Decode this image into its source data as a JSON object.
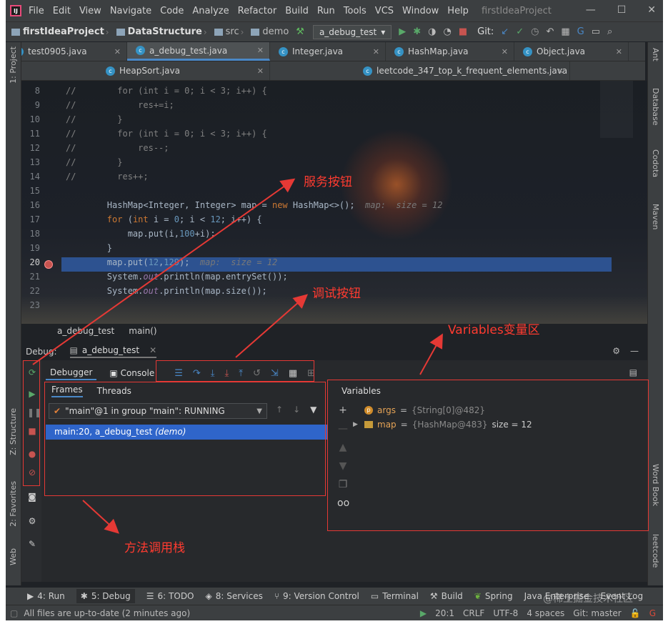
{
  "menubar": {
    "items": [
      "File",
      "Edit",
      "View",
      "Navigate",
      "Code",
      "Analyze",
      "Refactor",
      "Build",
      "Run",
      "Tools",
      "VCS",
      "Window",
      "Help"
    ],
    "title": "firstIdeaProject"
  },
  "navbar": {
    "crumbs": [
      "firstIdeaProject",
      "DataStructure",
      "src",
      "demo"
    ],
    "run_config": "a_debug_test",
    "git_label": "Git:"
  },
  "tabs_row1": [
    "test0905.java",
    "a_debug_test.java",
    "Integer.java",
    "HashMap.java",
    "Object.java"
  ],
  "tabs_row2": [
    "HeapSort.java",
    "leetcode_347_top_k_frequent_elements.java"
  ],
  "left_strip": {
    "project": "1: Project",
    "structure": "Z: Structure",
    "favorites": "2: Favorites",
    "web": "Web"
  },
  "right_strip": {
    "ant": "Ant",
    "database": "Database",
    "codota": "Codota",
    "maven": "Maven",
    "wordbook": "Word Book",
    "leetcode": "leetcode"
  },
  "editor": {
    "lines": [
      {
        "n": "8",
        "text": "//        for (int i = 0; i < 3; i++) {"
      },
      {
        "n": "9",
        "text": "//            res+=i;"
      },
      {
        "n": "10",
        "text": "//        }"
      },
      {
        "n": "11",
        "text": "//        for (int i = 0; i < 3; i++) {"
      },
      {
        "n": "12",
        "text": "//            res--;"
      },
      {
        "n": "13",
        "text": "//        }"
      },
      {
        "n": "14",
        "text": "//        res++;"
      },
      {
        "n": "15",
        "text": ""
      },
      {
        "n": "16",
        "text": "        HashMap<Integer, Integer> map = new HashMap<>();"
      },
      {
        "n": "17",
        "text": "        for (int i = 0; i < 12; i++) {"
      },
      {
        "n": "18",
        "text": "            map.put(i,100+i);"
      },
      {
        "n": "19",
        "text": "        }"
      },
      {
        "n": "20",
        "text": "        map.put(12,129);"
      },
      {
        "n": "21",
        "text": "        System.out.println(map.entrySet());"
      },
      {
        "n": "22",
        "text": "        System.out.println(map.size());"
      },
      {
        "n": "23",
        "text": ""
      }
    ],
    "hint16": "map:  size = 12",
    "hint20": "map:  size = 12",
    "breadcrumb_class": "a_debug_test",
    "breadcrumb_method": "main()"
  },
  "debug": {
    "label": "Debug:",
    "tab": "a_debug_test",
    "subtabs": [
      "Debugger",
      "Console"
    ],
    "frames_tabs": [
      "Frames",
      "Threads"
    ],
    "thread": "\"main\"@1 in group \"main\": RUNNING",
    "frame_row": "main:20, a_debug_test",
    "frame_row_pkg": "(demo)",
    "variables_title": "Variables",
    "vars": [
      {
        "name": "args",
        "value": "{String[0]@482}",
        "extra": ""
      },
      {
        "name": "map",
        "value": "{HashMap@483}",
        "extra": " size = 12"
      }
    ]
  },
  "annotations": {
    "service_buttons": "服务按钮",
    "debug_buttons": "调试按钮",
    "variables_area": "Variables变量区",
    "call_stack": "方法调用栈"
  },
  "bottom_bar": [
    "4: Run",
    "5: Debug",
    "6: TODO",
    "8: Services",
    "9: Version Control",
    "Terminal",
    "Build",
    "Spring",
    "Java Enterprise",
    "Event Log"
  ],
  "status": {
    "message": "All files are up-to-date (2 minutes ago)",
    "position": "20:1",
    "line_sep": "CRLF",
    "encoding": "UTF-8",
    "indent": "4 spaces",
    "git": "Git: master"
  },
  "watermark": "@稀土掘金技术社区",
  "colors": {
    "annotation_red": "#e53935",
    "highlight_line": "#2d5290",
    "frame_selection": "#2f65ca"
  }
}
